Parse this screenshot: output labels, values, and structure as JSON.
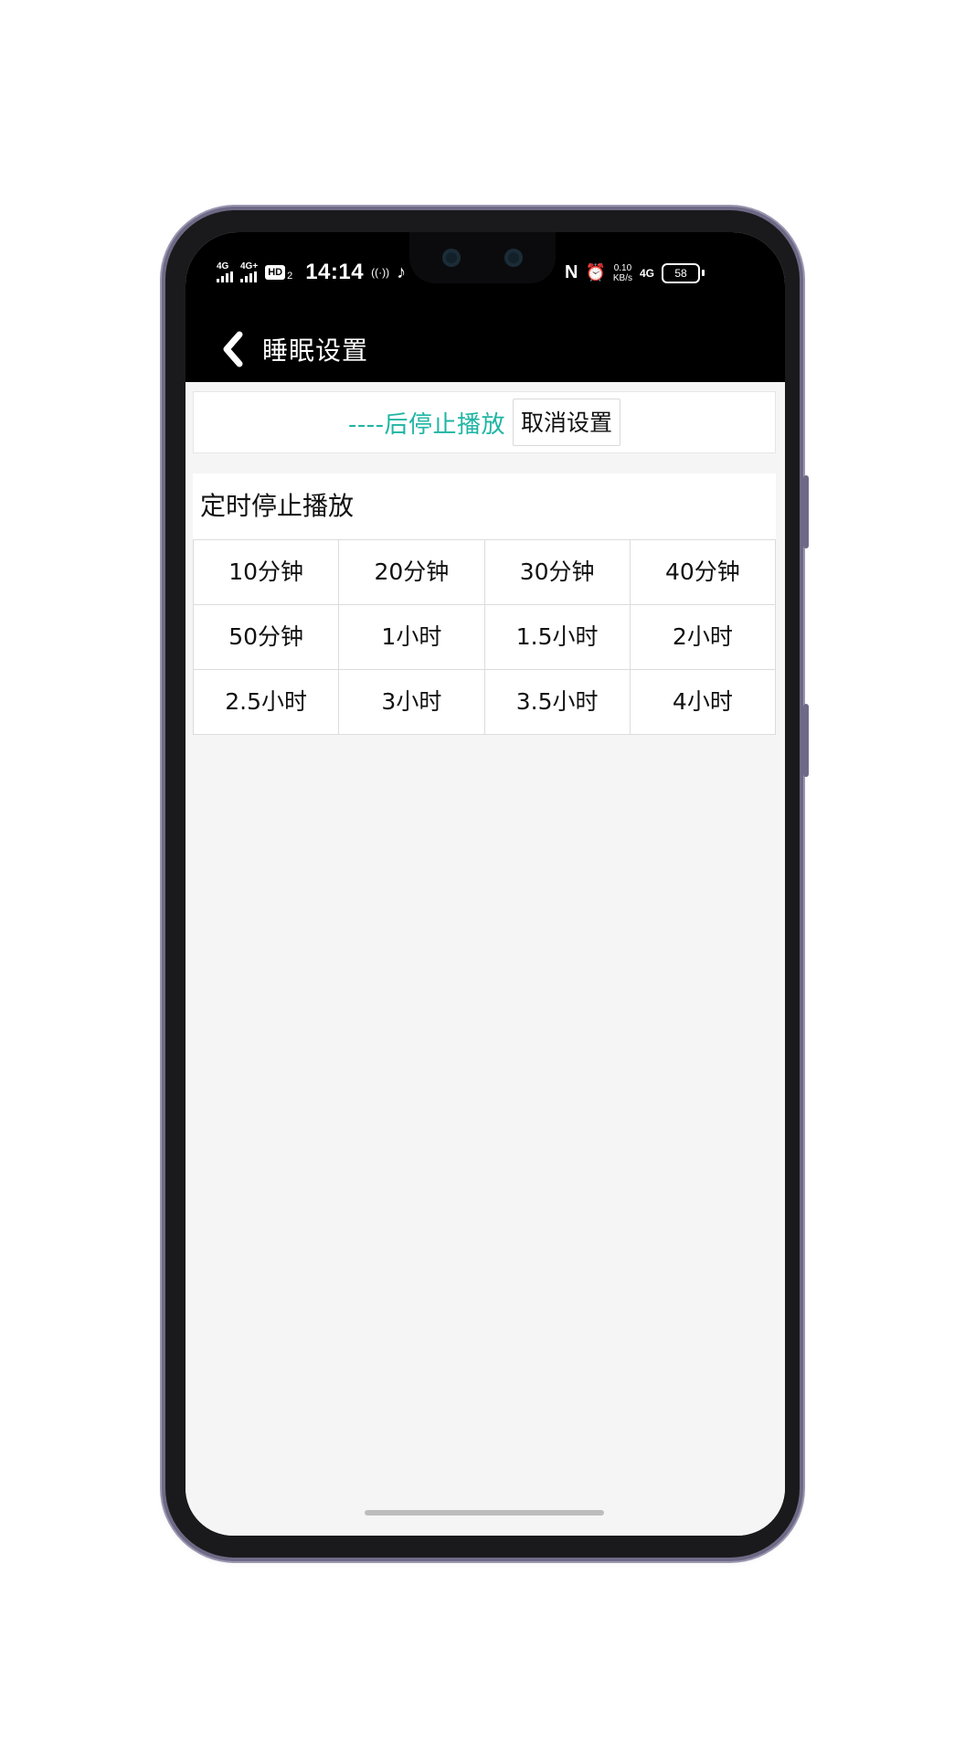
{
  "status_bar": {
    "signal1_label": "4G",
    "signal2_label": "4G+",
    "hd_label": "HD",
    "hd_sub": "2",
    "time": "14:14",
    "hotspot_glyph": "((·))",
    "tiktok_glyph": "♪",
    "nfc_glyph": "N",
    "alarm_glyph": "⏰",
    "net_speed_value": "0.10",
    "net_speed_unit": "KB/s",
    "data_label": "4G",
    "battery_level": "58"
  },
  "app_bar": {
    "back_icon": "chevron-left-icon",
    "title": "睡眠设置"
  },
  "timer_status": {
    "text": "----后停止播放",
    "cancel_label": "取消设置",
    "accent_color": "#1fb5a3"
  },
  "timer_section": {
    "title": "定时停止播放",
    "options": [
      "10分钟",
      "20分钟",
      "30分钟",
      "40分钟",
      "50分钟",
      "1小时",
      "1.5小时",
      "2小时",
      "2.5小时",
      "3小时",
      "3.5小时",
      "4小时"
    ]
  }
}
